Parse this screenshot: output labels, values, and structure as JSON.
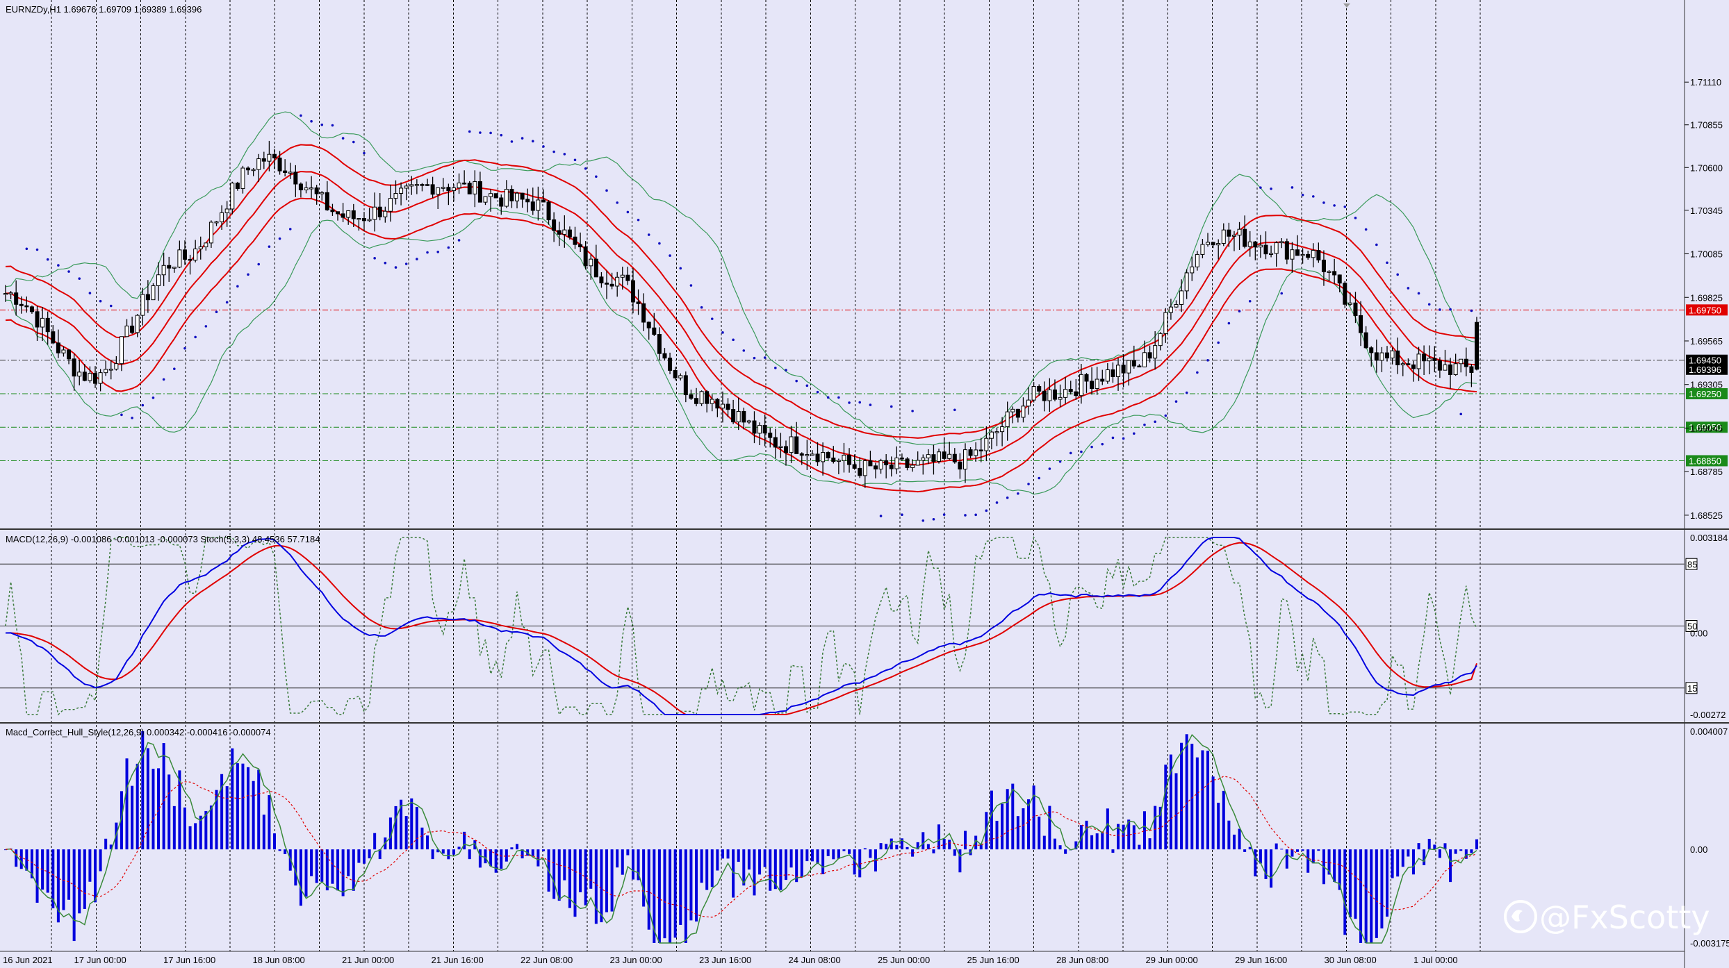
{
  "main": {
    "header": "EURNZDy,H1  1.69676 1.69709 1.69389 1.69396",
    "price_ticks": [
      "1.71110",
      "1.70855",
      "1.70600",
      "1.70345",
      "1.70085",
      "1.69825",
      "1.69565",
      "1.69305",
      "1.69045",
      "1.68785",
      "1.68525"
    ],
    "tags": [
      {
        "text": "1.69750",
        "color": "#e00000"
      },
      {
        "text": "1.69450",
        "color": "#000000"
      },
      {
        "text": "1.69396",
        "color": "#000000"
      },
      {
        "text": "1.69250",
        "color": "#1a8a1a"
      },
      {
        "text": "1.69050",
        "color": "#1a8a1a"
      },
      {
        "text": "1.68850",
        "color": "#1a8a1a"
      }
    ]
  },
  "macd_panel": {
    "header": "MACD(12,26,9) -0.001086 -0.001013 -0.000073  Stoch(5,3,3) 48.4536 57.7184",
    "ticks": [
      "0.003184",
      "0.00",
      "-0.00272"
    ],
    "levels": [
      "85",
      "50",
      "15"
    ]
  },
  "hull_panel": {
    "header": "Macd_Correct_Hull_Style(12,26,9) 0.000342 -0.000416 -0.000074",
    "ticks": [
      "0.004007",
      "0.00",
      "-0.003175"
    ]
  },
  "time_labels": [
    "16 Jun 2021",
    "17 Jun 00:00",
    "17 Jun 16:00",
    "18 Jun 08:00",
    "21 Jun 00:00",
    "21 Jun 16:00",
    "22 Jun 08:00",
    "23 Jun 00:00",
    "23 Jun 16:00",
    "24 Jun 08:00",
    "25 Jun 00:00",
    "25 Jun 16:00",
    "28 Jun 08:00",
    "29 Jun 00:00",
    "29 Jun 16:00",
    "30 Jun 08:00",
    "1 Jul 00:00"
  ],
  "watermark": "@FxScotty",
  "colors": {
    "background": "#e6e6f8",
    "candle": "#000000",
    "ma_red": "#e00000",
    "bollinger": "#3a9a5a",
    "psar": "#1010c0",
    "macd_blue": "#0000e0",
    "stoch": "#3a7a3a",
    "histogram": "#0000dd"
  },
  "chart_data": {
    "type": "candlestick",
    "symbol": "EURNZDy",
    "timeframe": "H1",
    "last_bar": {
      "open": 1.69676,
      "high": 1.69709,
      "low": 1.69389,
      "close": 1.69396
    },
    "price_range": [
      1.6845,
      1.716
    ],
    "horizontal_levels": [
      1.6975,
      1.6945,
      1.6925,
      1.6905,
      1.6885
    ],
    "close_path": [
      {
        "time": "16 Jun 2021",
        "close": 1.6985
      },
      {
        "time": "17 Jun 00:00",
        "close": 1.6935
      },
      {
        "time": "17 Jun 16:00",
        "close": 1.7005
      },
      {
        "time": "18 Jun 08:00",
        "close": 1.7065
      },
      {
        "time": "21 Jun 00:00",
        "close": 1.703
      },
      {
        "time": "21 Jun 16:00",
        "close": 1.705
      },
      {
        "time": "22 Jun 08:00",
        "close": 1.704
      },
      {
        "time": "23 Jun 00:00",
        "close": 1.6995
      },
      {
        "time": "23 Jun 16:00",
        "close": 1.6925
      },
      {
        "time": "24 Jun 08:00",
        "close": 1.6895
      },
      {
        "time": "25 Jun 00:00",
        "close": 1.688
      },
      {
        "time": "25 Jun 16:00",
        "close": 1.6885
      },
      {
        "time": "28 Jun 08:00",
        "close": 1.6925
      },
      {
        "time": "29 Jun 00:00",
        "close": 1.694
      },
      {
        "time": "29 Jun 16:00",
        "close": 1.702
      },
      {
        "time": "30 Jun 08:00",
        "close": 1.701
      },
      {
        "time": "1 Jul 00:00",
        "close": 1.6945
      },
      {
        "time": "last",
        "close": 1.69396
      }
    ],
    "macd": {
      "main": -0.001086,
      "signal": -0.001013,
      "hist": -7.3e-05,
      "range": [
        -0.00272,
        0.003184
      ]
    },
    "stochastic": {
      "k": 48.4536,
      "d": 57.7184,
      "levels": [
        15,
        50,
        85
      ]
    },
    "macd_hull": {
      "values": [
        0.000342,
        -0.000416,
        -7.4e-05
      ],
      "range": [
        -0.003175,
        0.004007
      ]
    }
  }
}
